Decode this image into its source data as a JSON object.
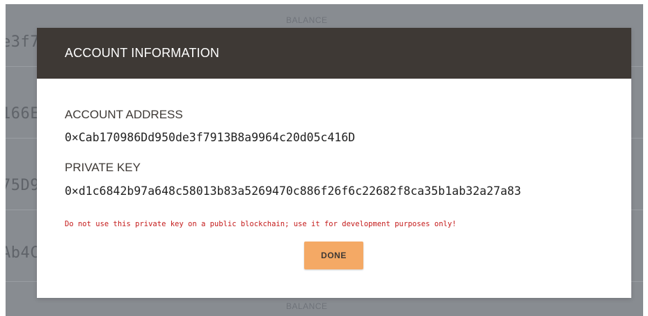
{
  "background": {
    "balance_label_top": "BALANCE",
    "balance_label_bottom": "BALANCE",
    "address_fragments": [
      "e3f7",
      "166E",
      "75D9",
      "Ab4C"
    ]
  },
  "modal": {
    "title": "ACCOUNT INFORMATION",
    "address_label": "ACCOUNT ADDRESS",
    "address_value": "0×Cab170986Dd950de3f7913B8a9964c20d05c416D",
    "private_key_label": "PRIVATE KEY",
    "private_key_value": "0×d1c6842b97a648c58013b83a5269470c886f26f6c22682f8ca35b1ab32a27a83",
    "warning": "Do not use this private key on a public blockchain; use it for development purposes only!",
    "done_label": "DONE"
  },
  "colors": {
    "header_bg": "#3e3935",
    "done_button": "#f4a965",
    "warning_text": "#c41a1a",
    "overlay": "#888c91"
  }
}
